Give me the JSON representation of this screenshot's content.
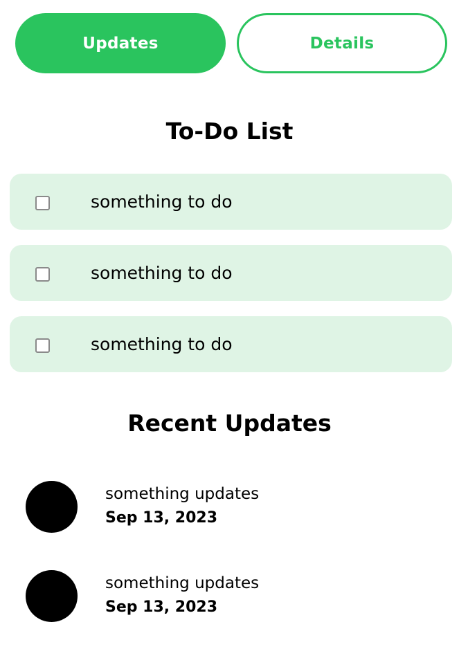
{
  "tabs": {
    "updates_label": "Updates",
    "details_label": "Details",
    "active": "Updates"
  },
  "colors": {
    "accent": "#2ac45e",
    "todo_background": "#dff4e5",
    "avatar": "#000000"
  },
  "todo": {
    "title": "To-Do List",
    "items": [
      {
        "label": "something to do",
        "checked": false
      },
      {
        "label": "something to do",
        "checked": false
      },
      {
        "label": "something to do",
        "checked": false
      }
    ]
  },
  "updates": {
    "title": "Recent Updates",
    "items": [
      {
        "text": "something updates",
        "date": "Sep 13, 2023",
        "icon": "avatar-icon"
      },
      {
        "text": "something updates",
        "date": "Sep 13, 2023",
        "icon": "avatar-icon"
      }
    ]
  }
}
